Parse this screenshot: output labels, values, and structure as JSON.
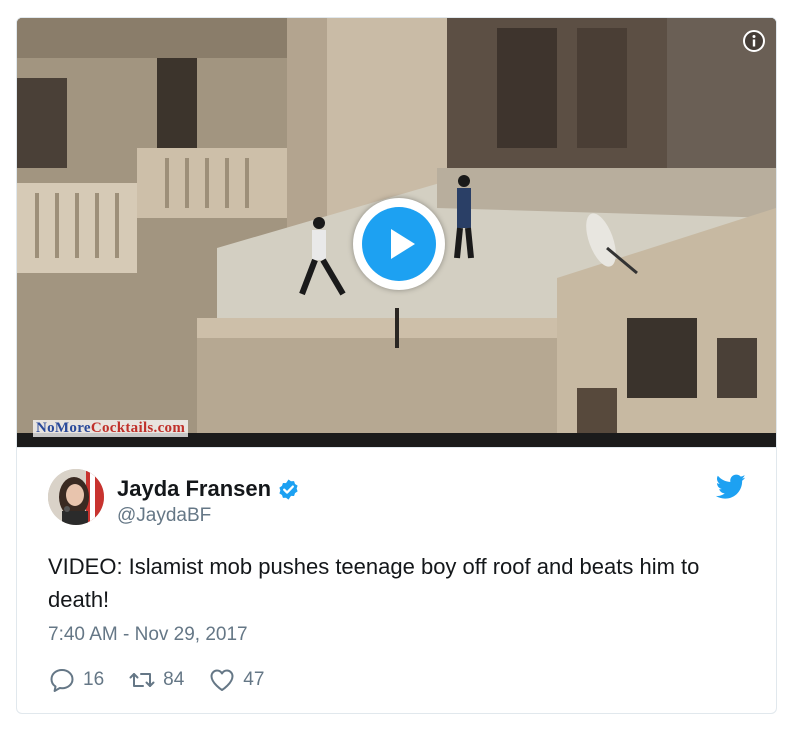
{
  "media": {
    "watermark_part1": "NoMore",
    "watermark_part2": "Cocktails.com",
    "play_icon": "play-icon",
    "info_icon": "info-icon"
  },
  "tweet": {
    "author_name": "Jayda Fransen",
    "author_handle": "@JaydaBF",
    "verified_icon": "verified-badge-icon",
    "platform_icon": "twitter-bird-icon",
    "text": "VIDEO: Islamist mob pushes teenage boy off roof and beats him to death!",
    "timestamp": "7:40 AM - Nov 29, 2017",
    "reply_count": "16",
    "retweet_count": "84",
    "like_count": "47"
  },
  "colors": {
    "accent": "#1da1f2",
    "text": "#14171a",
    "muted": "#657786",
    "border": "#e1e8ed"
  }
}
